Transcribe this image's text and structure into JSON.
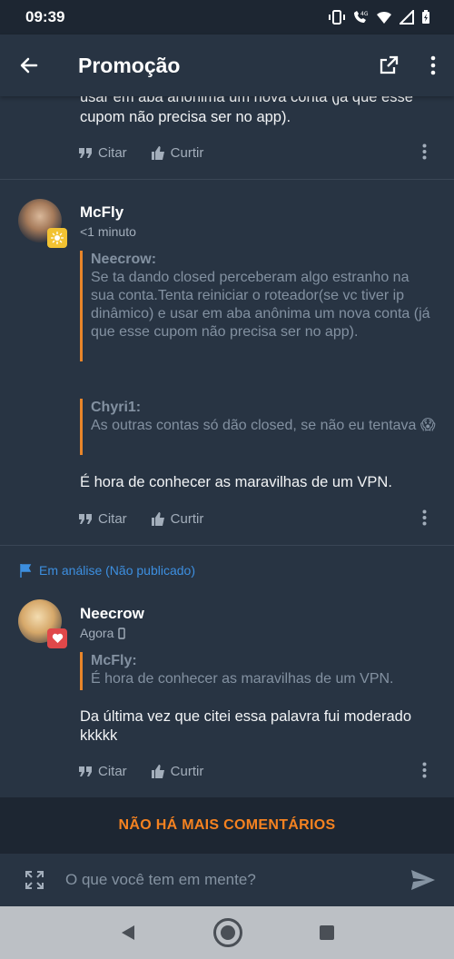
{
  "status": {
    "time": "09:39"
  },
  "appbar": {
    "title": "Promoção"
  },
  "partial_comment": {
    "text": "usar em aba anônima um nova conta (já que esse cupom não precisa ser no app)."
  },
  "actions": {
    "quote_label": "Citar",
    "like_label": "Curtir"
  },
  "comment_mcfly": {
    "username": "McFly",
    "time": "<1 minuto",
    "quote1_name": "Neecrow:",
    "quote1_text": "Se ta dando closed perceberam algo estranho na sua conta.Tenta reiniciar o roteador(se vc tiver ip dinâmico) e usar em aba anônima um nova conta (já que esse cupom não precisa ser no app).",
    "quote2_name": "Chyri1:",
    "quote2_text": "As outras contas só dão closed, se não eu tentava 😱",
    "body": "É hora de conhecer as maravilhas de um VPN."
  },
  "analysis_label": "Em análise (Não publicado)",
  "comment_neecrow": {
    "username": "Neecrow",
    "time": "Agora",
    "quote_name": "McFly:",
    "quote_text": "É hora de conhecer as maravilhas de um VPN.",
    "body": "Da última vez que citei essa palavra fui moderado kkkkk"
  },
  "footer": {
    "no_more": "NÃO HÁ MAIS COMENTÁRIOS"
  },
  "composer": {
    "placeholder": "O que você tem em mente?"
  },
  "colors": {
    "accent": "#f58220",
    "quote_border": "#e8852a",
    "link": "#3d8fe0",
    "background": "#283443"
  }
}
